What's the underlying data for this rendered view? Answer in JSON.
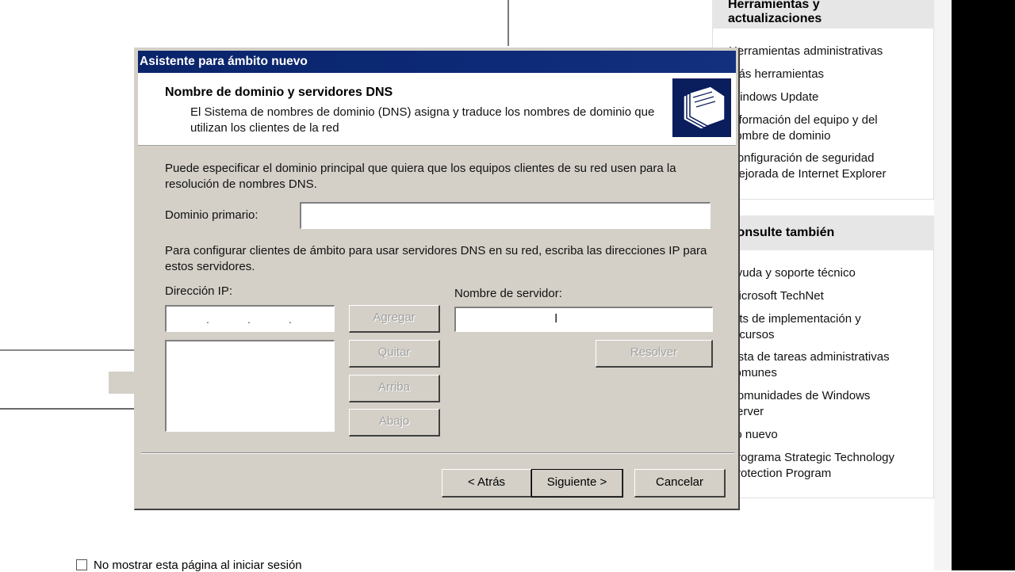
{
  "background": {
    "right_panel": {
      "section1": {
        "title": "Herramientas y actualizaciones",
        "items": [
          "Herramientas administrativas",
          "Más herramientas",
          "Windows Update",
          "Información del equipo y del nombre de dominio",
          "Configuración de seguridad mejorada de Internet Explorer"
        ]
      },
      "section2": {
        "title": "Consulte también",
        "items": [
          "Ayuda y soporte técnico",
          "Microsoft TechNet",
          "Kits de implementación y recursos",
          "Lista de tareas administrativas comunes",
          "Comunidades de Windows Server",
          "Lo nuevo",
          "Programa Strategic Technology Protection Program"
        ]
      }
    },
    "checkbox_label": "No mostrar esta página al iniciar sesión"
  },
  "dialog": {
    "title": "Asistente para ámbito nuevo",
    "header_title": "Nombre de dominio y servidores DNS",
    "header_subtitle": "El Sistema de nombres de dominio (DNS) asigna y traduce los nombres de dominio que utilizan los clientes de la red",
    "intro_text": "Puede especificar el dominio principal que quiera que los equipos clientes de su red usen para la resolución de nombres DNS.",
    "primary_domain_label": "Dominio primario:",
    "primary_domain_value": "",
    "dns_text": "Para configurar clientes de ámbito para usar servidores DNS en su red, escriba las direcciones IP para estos servidores.",
    "ip_label": "Dirección IP:",
    "server_name_label": "Nombre de servidor:",
    "server_name_value": "",
    "buttons": {
      "add": "Agregar",
      "remove": "Quitar",
      "up": "Arriba",
      "down": "Abajo",
      "resolve": "Resolver",
      "back": "< Atrás",
      "next": "Siguiente >",
      "cancel": "Cancelar"
    },
    "colors": {
      "titlebar": "#0a246a",
      "dialog_face": "#d4d0c8"
    }
  }
}
